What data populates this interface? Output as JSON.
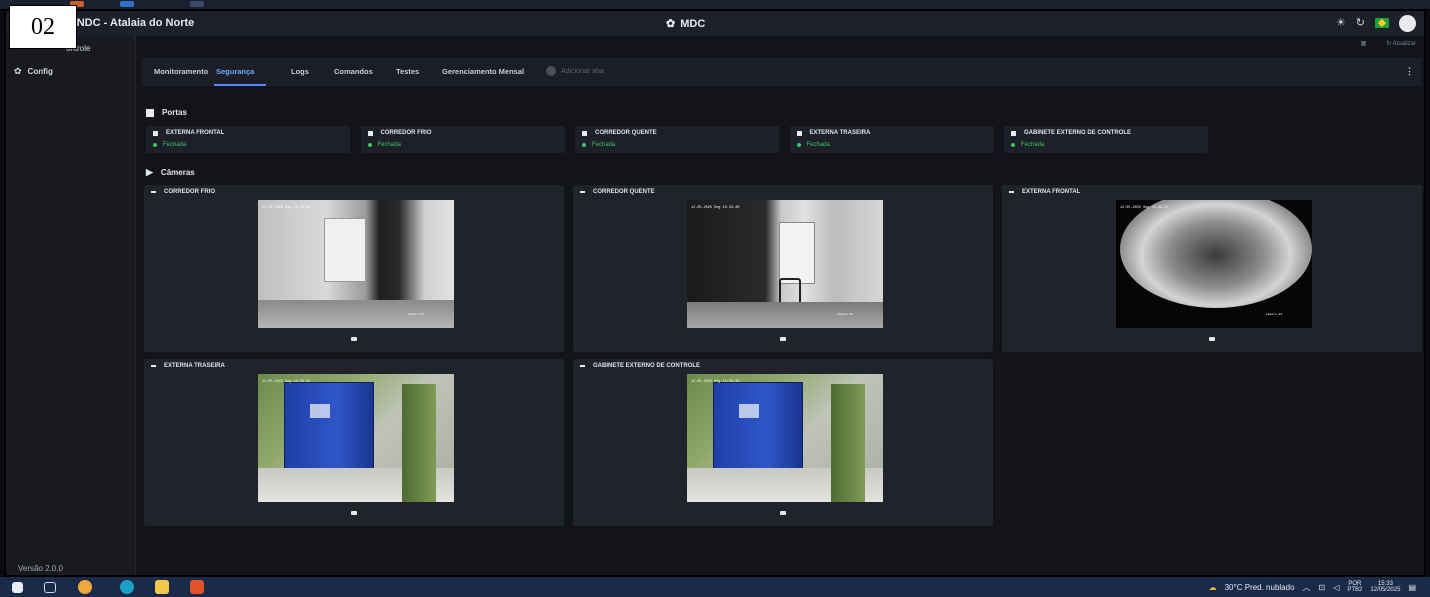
{
  "badge": "02",
  "app": {
    "title": ": NDC - Atalaia do Norte",
    "center_title": "MDC",
    "refresh_label": "Atualizar"
  },
  "sidebar": {
    "items": [
      {
        "label": "ontrole",
        "icon": "dashboard-icon"
      },
      {
        "label": "Config",
        "icon": "gear-icon"
      }
    ],
    "version": "Versão 2.0.0"
  },
  "tabs": [
    {
      "label": "Monitoramento",
      "active": false
    },
    {
      "label": "Segurança",
      "active": true
    },
    {
      "label": "Logs",
      "active": false
    },
    {
      "label": "Comandos",
      "active": false
    },
    {
      "label": "Testes",
      "active": false
    },
    {
      "label": "Gerenciamento Mensal",
      "active": false
    }
  ],
  "add_tab_label": "Adicionar aba",
  "sections": {
    "doors_title": "Portas",
    "cameras_title": "Câmeras"
  },
  "doors": [
    {
      "name": "EXTERNA FRONTAL",
      "status": "Fechada"
    },
    {
      "name": "CORREDOR FRIO",
      "status": "Fechada"
    },
    {
      "name": "CORREDOR QUENTE",
      "status": "Fechada"
    },
    {
      "name": "EXTERNA TRASEIRA",
      "status": "Fechada"
    },
    {
      "name": "GABINETE EXTERNO DE CONTROLE",
      "status": "Fechada"
    }
  ],
  "cameras": [
    {
      "name": "CORREDOR FRIO",
      "timestamp": "12-05-2025 Seg 15:33:40",
      "label": "Camera 01",
      "style": "gray-corridor"
    },
    {
      "name": "CORREDOR QUENTE",
      "timestamp": "12-05-2025 Seg 15:33:40",
      "label": "Camera 02",
      "style": "dark-corridor"
    },
    {
      "name": "EXTERNA FRONTAL",
      "timestamp": "12-05-2025 Seg 15:33:27",
      "label": "Camera 03",
      "style": "fisheye-night"
    },
    {
      "name": "EXTERNA TRASEIRA",
      "timestamp": "12-05-2025 Seg 15:33:40",
      "label": "",
      "style": "container-outdoor"
    },
    {
      "name": "GABINETE EXTERNO DE CONTROLE",
      "timestamp": "12-05-2025 Seg 15:33:40",
      "label": "",
      "style": "container-outdoor"
    }
  ],
  "taskbar": {
    "weather": "30°C Pred. nublado",
    "lang_top": "POR",
    "lang_bottom": "PTB2",
    "time": "15:33",
    "date": "12/05/2025"
  },
  "colors": {
    "accent": "#4d8dff",
    "status_ok": "#3fc36e",
    "background": "#121419",
    "card": "#1d2029"
  }
}
